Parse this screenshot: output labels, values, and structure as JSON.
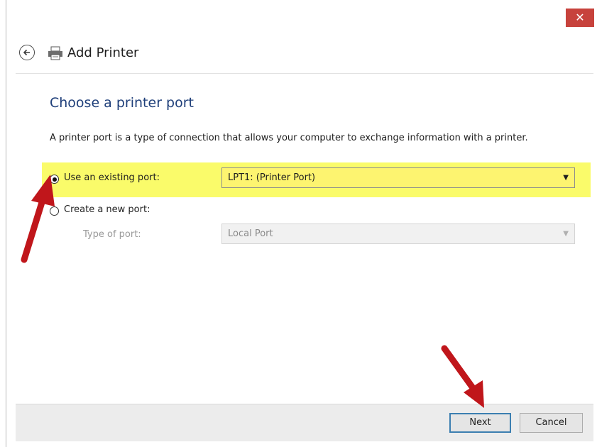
{
  "window": {
    "close_label": "✕"
  },
  "header": {
    "title": "Add Printer",
    "back_icon": "back-arrow-icon",
    "app_icon": "printer-icon"
  },
  "main": {
    "heading": "Choose a printer port",
    "description": "A printer port is a type of connection that allows your computer to exchange information with a printer.",
    "existing_port": {
      "label": "Use an existing port:",
      "selected": true,
      "value": "LPT1: (Printer Port)"
    },
    "new_port": {
      "label": "Create a new port:",
      "selected": false,
      "type_label": "Type of port:",
      "value": "Local Port"
    }
  },
  "footer": {
    "next_label": "Next",
    "cancel_label": "Cancel"
  },
  "colors": {
    "highlight": "#fafb6a",
    "heading": "#1f3f7a",
    "close": "#c7423c",
    "annotation_arrow": "#c0161b"
  }
}
